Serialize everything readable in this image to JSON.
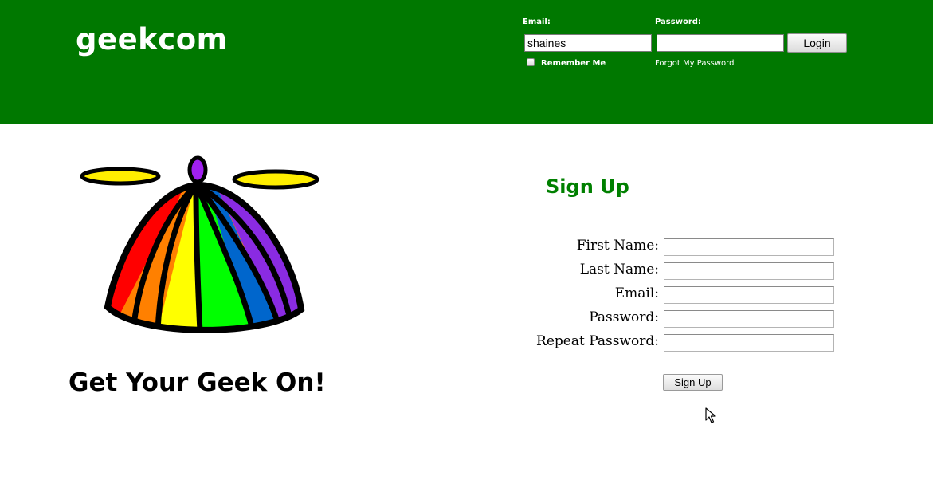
{
  "header": {
    "brand": "geekcom",
    "background_color": "#007800",
    "login": {
      "email_label": "Email:",
      "email_value": "shaines",
      "password_label": "Password:",
      "password_value": "",
      "login_button": "Login",
      "remember_me_label": "Remember Me",
      "remember_me_checked": false,
      "forgot_password_link": "Forgot My Password"
    }
  },
  "hero": {
    "image_icon": "propeller-beanie-icon",
    "tagline": "Get Your Geek On!"
  },
  "signup": {
    "title": "Sign Up",
    "title_color": "#008000",
    "fields": [
      {
        "label": "First Name:",
        "value": ""
      },
      {
        "label": "Last Name:",
        "value": ""
      },
      {
        "label": "Email:",
        "value": ""
      },
      {
        "label": "Password:",
        "value": ""
      },
      {
        "label": "Repeat Password:",
        "value": ""
      }
    ],
    "submit_button": "Sign Up"
  }
}
